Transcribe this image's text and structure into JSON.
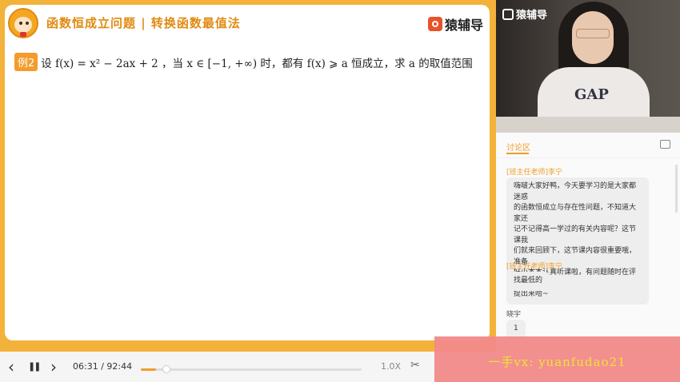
{
  "slide": {
    "title": "函数恒成立问题 | 转换函数最值法",
    "brand": "猿辅导",
    "example_badge": "例2",
    "problem_text": "设 f(x) = x² − 2ax + 2 ，当 x ∈ [−1, +∞) 时，都有 f(x) ⩾ a 恒成立，求 a 的取值范围"
  },
  "video": {
    "logo_text": "猿辅导",
    "shirt_text": "GAP"
  },
  "chat": {
    "title": "讨论区",
    "messages": [
      {
        "author": "[班主任老师]李宁",
        "author_color": "#f39c2c",
        "lines": [
          "嗨啵大家好鸭，今天要学习的是大家都迷惑",
          "的函数恒成立与存在性问题，不知道大家还",
          "记不记得高一学过的有关内容呢？这节课我",
          "们就来回顾下，这节课内容很重要哦，准备",
          "好小本本认真听课啦，有问题随时在评论区",
          "提出来哈~"
        ]
      },
      {
        "author": "[班主任老师]李宁",
        "author_color": "#f39c2c",
        "lines": [
          "找最低的"
        ]
      },
      {
        "author": "晓宇",
        "author_color": "#555555",
        "lines": [
          "1"
        ]
      }
    ]
  },
  "player": {
    "prev_icon": "‹",
    "pause_icon": "❚❚",
    "next_icon": "›",
    "time": "06:31 / 92:44",
    "progress": 0.07,
    "speed": "1.0X",
    "clip_icon": "✂"
  },
  "watermark": {
    "text": "一手vx: yuanfudao21"
  },
  "colors": {
    "accent": "#f39c2c",
    "frame": "#f3b23a",
    "watermark_bg": "#f28a8a",
    "watermark_text": "#f2e12b"
  }
}
